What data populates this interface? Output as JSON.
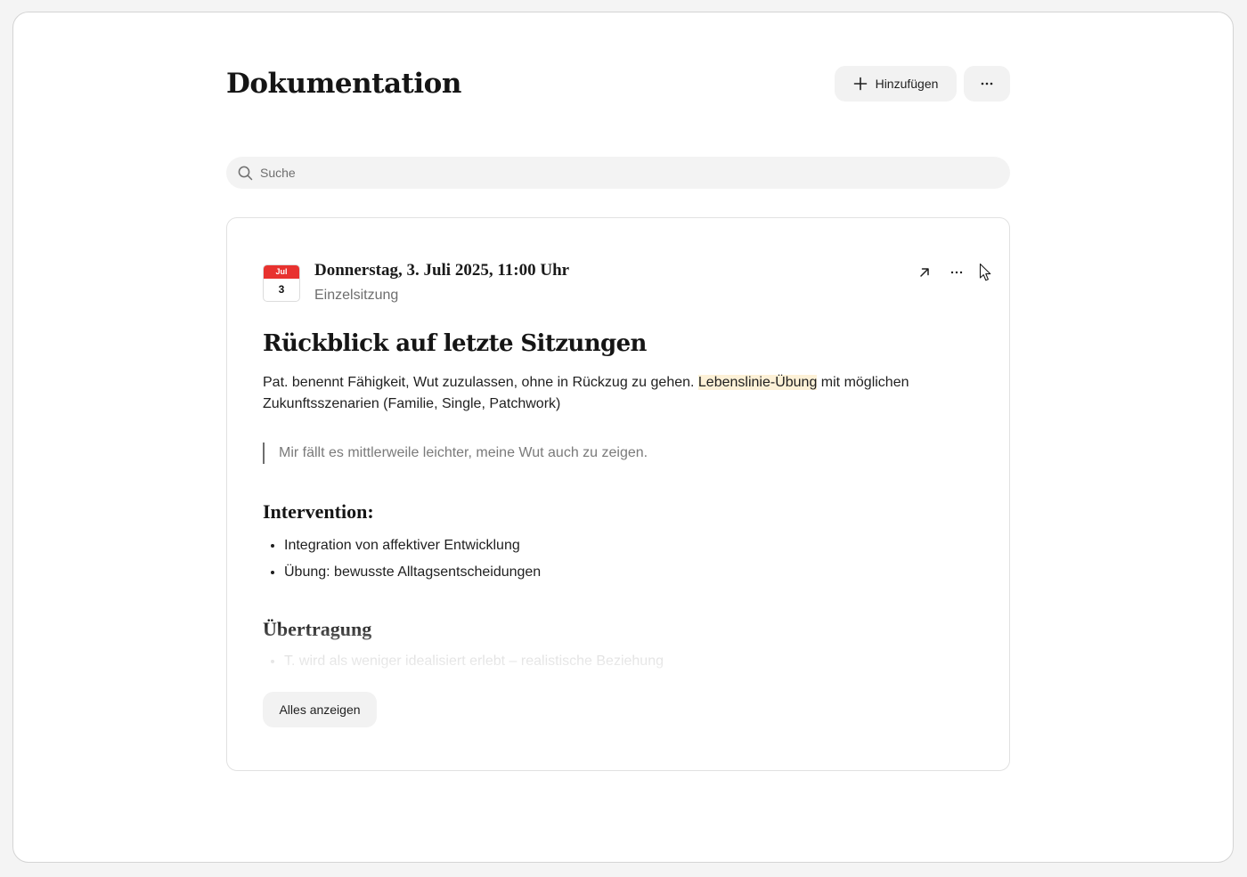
{
  "page": {
    "title": "Dokumentation"
  },
  "toolbar": {
    "add_label": "Hinzufügen",
    "add_icon": "plus-icon",
    "more_icon": "more-horizontal-icon"
  },
  "search": {
    "placeholder": "Suche",
    "icon": "search-icon"
  },
  "entry": {
    "calendar": {
      "month": "Jul",
      "day": "3",
      "accent_color": "#e8322f"
    },
    "date_time": "Donnerstag, 3. Juli 2025, 11:00 Uhr",
    "session_type": "Einzelsitzung",
    "open_icon": "arrow-up-right-icon",
    "more_icon": "more-horizontal-icon",
    "title": "Rückblick auf letzte Sitzungen",
    "body_before": "Pat. benennt Fähigkeit, Wut zuzulassen, ohne in Rückzug zu gehen. ",
    "body_highlight": "Lebenslinie-Übung",
    "body_after": " mit möglichen Zukunftsszenarien (Familie, Single, Patchwork)",
    "highlight_color": "#fdf1d7",
    "quote": "Mir fällt es mittlerweile leichter, meine Wut auch zu zeigen.",
    "intervention": {
      "heading": "Intervention:",
      "items": [
        "Integration von affektiver Entwicklung",
        "Übung: bewusste Alltagsentscheidungen"
      ]
    },
    "transfer": {
      "heading": "Übertragung",
      "items": [
        "T. wird als weniger idealisiert erlebt – realistische Beziehung"
      ]
    },
    "show_all_label": "Alles anzeigen"
  }
}
